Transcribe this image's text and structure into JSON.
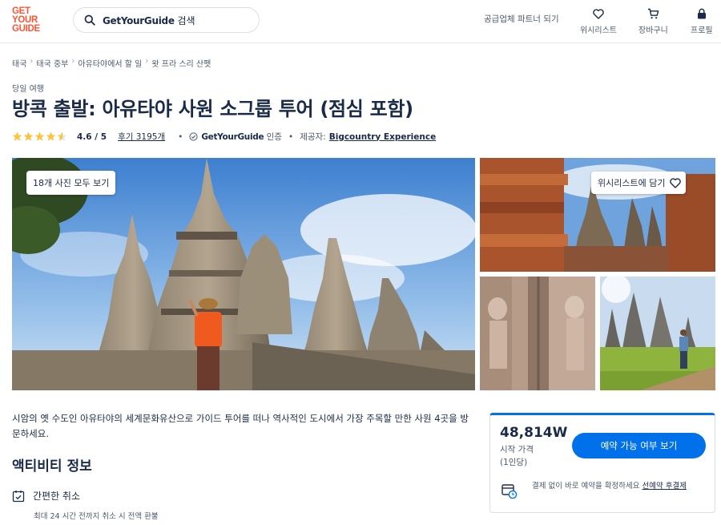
{
  "header": {
    "logo": [
      "GET",
      "YOUR",
      "GUIDE"
    ],
    "search_brand": "GetYourGuide",
    "search_suffix": " 검색",
    "partner_link": "공급업체 파트너 되기",
    "wishlist": "위시리스트",
    "cart": "장바구니",
    "profile": "프로필"
  },
  "breadcrumb": [
    "태국",
    "태국 중부",
    "아유타야에서 할 일",
    "왓 프라 스리 산펫"
  ],
  "breadcrumb_sep": "›",
  "activity": {
    "category": "당일 여행",
    "title": "방콕 출발: 아유타야 사원 소그룹 투어 (점심 포함)",
    "rating_value": "4.6 / 5",
    "rating_fraction": 0.92,
    "reviews": "후기 3195개",
    "verified_brand": "GetYourGuide",
    "verified_suffix": " 인증",
    "provider_label": "제공자:",
    "provider": "Bigcountry Experience"
  },
  "gallery": {
    "all_photos": "18개 사진 모두 보기",
    "wishlist_button": "위시리스트에 담기"
  },
  "description": "시암의 옛 수도인 아유타야의 세계문화유산으로 가이드 투어를 떠나 역사적인 도시에서 가장 주목할 만한 사원 4곳을 방문하세요.",
  "info": {
    "section_title": "액티비티 정보",
    "cancel_title": "간편한 취소",
    "cancel_sub": "최대 24 시간 전까지 취소 시 전액 환불"
  },
  "booking": {
    "price": "48,814W",
    "price_from": "시작 가격",
    "per_person": "(1인당)",
    "button": "예약 가능 여부 보기",
    "note": "결제 없이 바로 예약을 확정하세요 ",
    "note_link": "선예약 후결제"
  },
  "colors": {
    "brand": "#ff5533",
    "primary": "#0071eb",
    "text": "#1a2b49",
    "star": "#fdc33a"
  }
}
